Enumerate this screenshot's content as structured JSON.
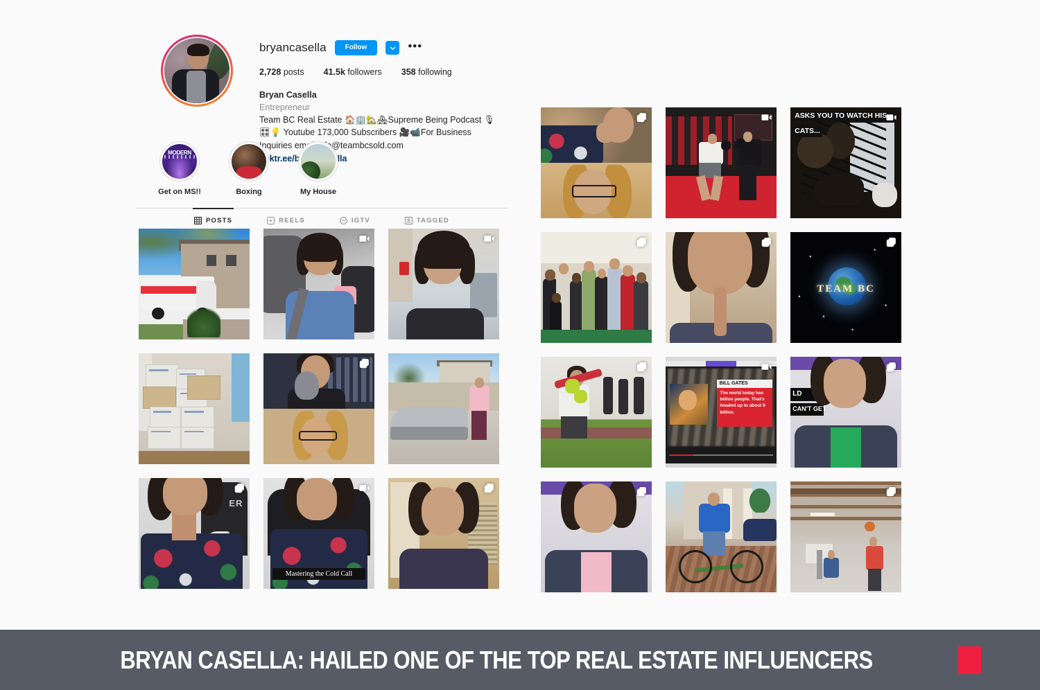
{
  "profile": {
    "username": "bryancasella",
    "follow_label": "Follow",
    "follow_dropdown_icon": "chevron-down-icon",
    "more_options_icon": "ellipsis-icon",
    "avatar_alt": "profile-photo",
    "stats": [
      {
        "value": "2,728",
        "label": "posts"
      },
      {
        "value": "41.5k",
        "label": "followers"
      },
      {
        "value": "358",
        "label": "following"
      }
    ],
    "full_name": "Bryan Casella",
    "category": "Entrepreneur",
    "bio": "Team BC Real Estate 🏠🏢🏡🏘Supreme Being Podcast 🎙🎛💡 Youtube 173,000 Subscribers 🎥📹For Business Inquiries email info@teambcsold.com",
    "link": "linktr.ee/bryancasella"
  },
  "highlights": [
    {
      "label": "Get on MS!!",
      "cover_text": "MODERN",
      "cover": "ms-cover"
    },
    {
      "label": "Boxing",
      "cover_text": "",
      "cover": "boxing-cover"
    },
    {
      "label": "My House",
      "cover_text": "",
      "cover": "house-cover"
    }
  ],
  "tabs": [
    {
      "label": "POSTS",
      "icon": "grid-icon",
      "active": true
    },
    {
      "label": "REELS",
      "icon": "reels-icon",
      "active": false
    },
    {
      "label": "IGTV",
      "icon": "igtv-icon",
      "active": false
    },
    {
      "label": "TAGGED",
      "icon": "tagged-icon",
      "active": false
    }
  ],
  "grid_left": [
    {
      "name": "post-uhaul-house",
      "scene": "s-uhaul",
      "badge": "none",
      "caption": ""
    },
    {
      "name": "post-car-selfie",
      "scene": "s-car",
      "badge": "video-icon",
      "caption": ""
    },
    {
      "name": "post-gym-talking-head",
      "scene": "s-gym",
      "badge": "video-icon",
      "caption": ""
    },
    {
      "name": "post-moving-boxes",
      "scene": "s-boxes",
      "badge": "none",
      "caption": ""
    },
    {
      "name": "post-video-call-cat",
      "scene": "s-zoom",
      "badge": "carousel-icon",
      "caption": ""
    },
    {
      "name": "post-lamborghini",
      "scene": "s-lambo",
      "badge": "none",
      "caption": ""
    },
    {
      "name": "post-gaming-chair-portrait",
      "scene": "s-chair",
      "badge": "carousel-icon",
      "caption": ""
    },
    {
      "name": "post-mastering-cold-call",
      "scene": "s-cold",
      "badge": "video-icon",
      "caption": "Mastering the Cold Call"
    },
    {
      "name": "post-home-talking-head",
      "scene": "s-home",
      "badge": "carousel-icon",
      "caption": ""
    }
  ],
  "grid_right": [
    {
      "name": "post-split-video-call",
      "scene": "s-split",
      "badge": "carousel-icon",
      "caption": ""
    },
    {
      "name": "post-boxing-gym-spar",
      "scene": "s-box",
      "badge": "video-icon",
      "caption": ""
    },
    {
      "name": "post-cats-story",
      "scene": "s-cats",
      "badge": "video-icon",
      "caption_line1": "ASKS YOU TO WATCH HIS",
      "caption_line2": "CATS..."
    },
    {
      "name": "post-group-photo",
      "scene": "s-group",
      "badge": "carousel-icon",
      "caption": ""
    },
    {
      "name": "post-shh-portrait",
      "scene": "s-shh",
      "badge": "carousel-icon",
      "caption": ""
    },
    {
      "name": "post-team-bc-logo",
      "scene": "s-team",
      "badge": "carousel-icon",
      "caption": "TEAM BC"
    },
    {
      "name": "post-turf-training",
      "scene": "s-turf",
      "badge": "carousel-icon",
      "caption": ""
    },
    {
      "name": "post-bill-gates-clip",
      "scene": "s-gates",
      "badge": "video-icon",
      "caption": "BILL GATES",
      "body": "The world today has billion people. That's headed up to about 9 billion."
    },
    {
      "name": "post-suit-green-shirt",
      "scene": "s-suit",
      "badge": "carousel-icon",
      "tee": "green",
      "overlay1": "LD",
      "overlay2": "CAN'T GET"
    },
    {
      "name": "post-suit-pink-shirt",
      "scene": "s-suit",
      "badge": "carousel-icon",
      "tee": "pink",
      "overlay1": "",
      "overlay2": ""
    },
    {
      "name": "post-bicycle",
      "scene": "s-bike",
      "badge": "none",
      "caption": ""
    },
    {
      "name": "post-basketball-warehouse",
      "scene": "s-ball",
      "badge": "carousel-icon",
      "caption": ""
    }
  ],
  "banner": {
    "text": "BRYAN CASELLA: HAILED ONE OF THE TOP REAL ESTATE INFLUENCERS",
    "accent_color": "#ee1f3f",
    "background_color": "#565b66"
  },
  "colors": {
    "page_background": "#fafafa",
    "instagram_blue": "#0095f6",
    "link_blue": "#00376b",
    "text_primary": "#262626",
    "text_secondary": "#8e8e8e",
    "border": "#dbdbdb"
  }
}
